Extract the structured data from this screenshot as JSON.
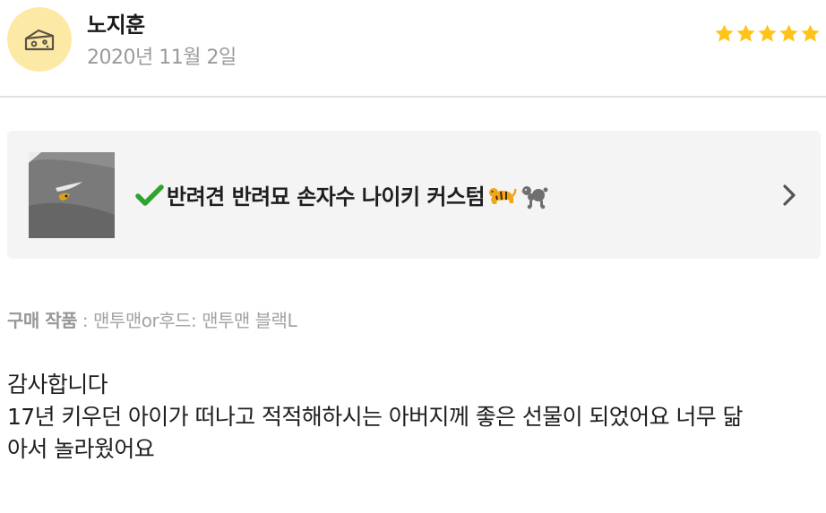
{
  "reviewer": {
    "name": "노지훈",
    "date": "2020년 11월 2일",
    "avatar_icon": "cheese-icon",
    "avatar_bg": "#fde9a6",
    "rating": 5,
    "rating_max": 5,
    "star_color": "#ffc31a"
  },
  "product": {
    "check_icon": "green-check-icon",
    "title": "반려견 반려묘 손자수 나이키 커스텀",
    "emojis": [
      "tiger-icon",
      "poodle-icon"
    ],
    "chevron_icon": "chevron-right-icon"
  },
  "purchase": {
    "label": "구매 작품",
    "separator": " : ",
    "option": "맨투맨or후드: 맨투맨 블랙L"
  },
  "review": {
    "lines": [
      "감사합니다",
      "17년 키우던 아이가 떠나고 적적해하시는 아버지께 좋은 선물이 되었어요 너무 닮",
      "아서 놀라웠어요"
    ]
  }
}
